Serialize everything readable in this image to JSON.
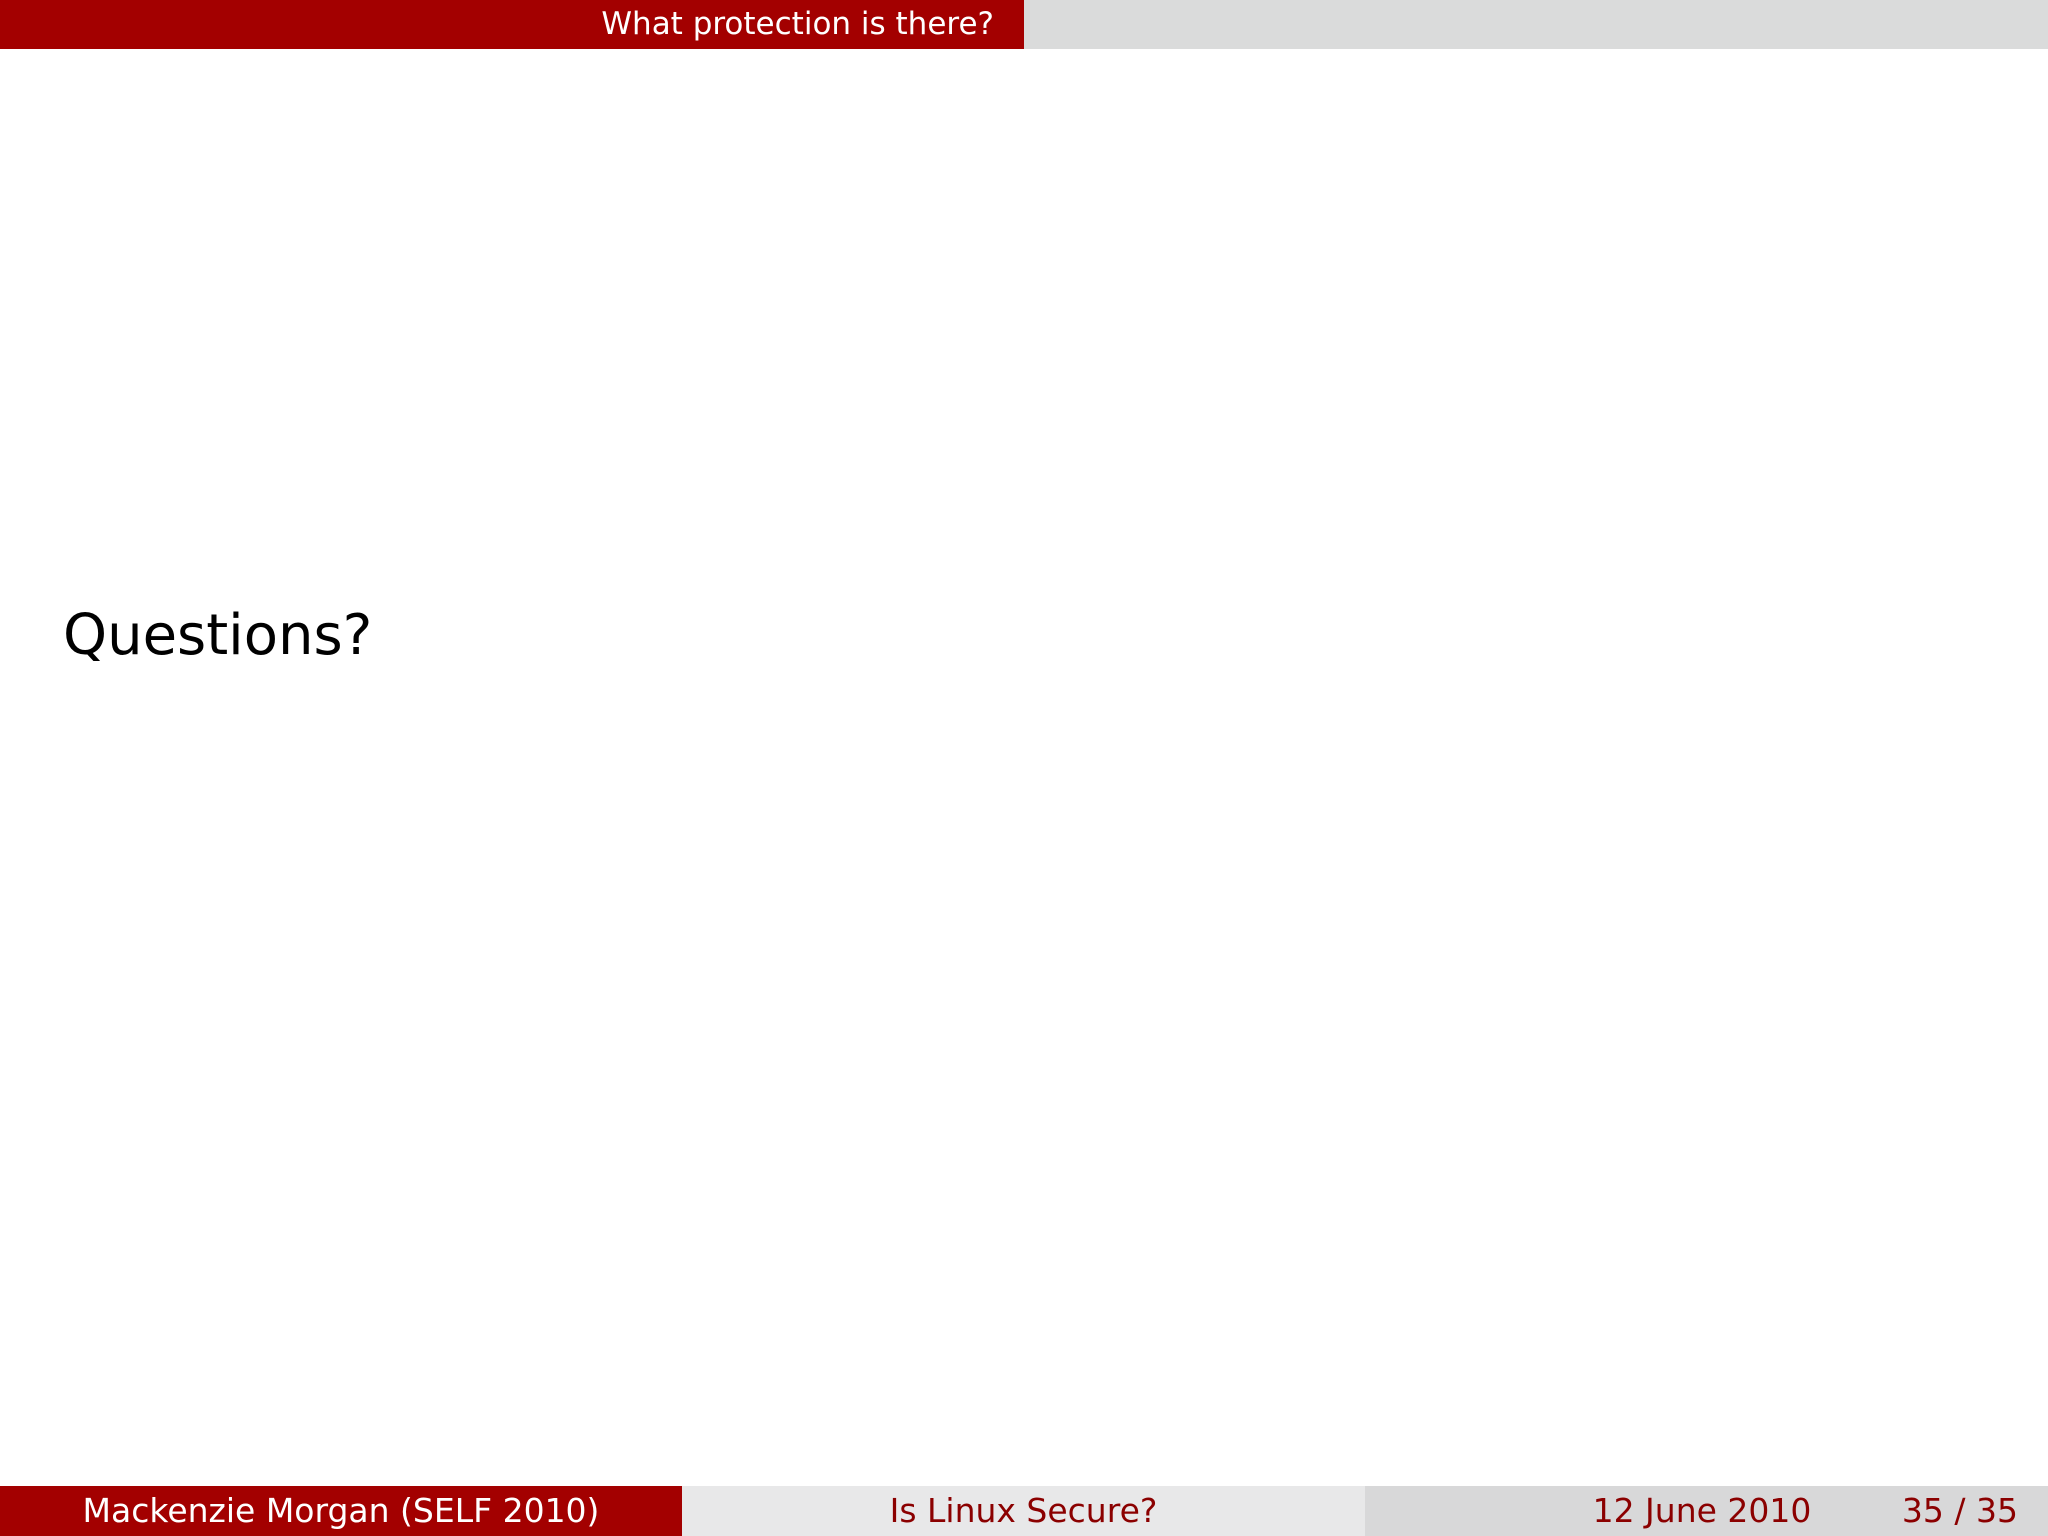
{
  "header": {
    "section_title": "What protection is there?"
  },
  "slide": {
    "body_text": "Questions?"
  },
  "footer": {
    "author": "Mackenzie Morgan  (SELF 2010)",
    "title": "Is Linux Secure?",
    "date": "12 June 2010",
    "page": "35 / 35"
  },
  "colors": {
    "accent": "#a30000",
    "footer_text": "#8b0000",
    "header_rest": "#dadbdb"
  }
}
